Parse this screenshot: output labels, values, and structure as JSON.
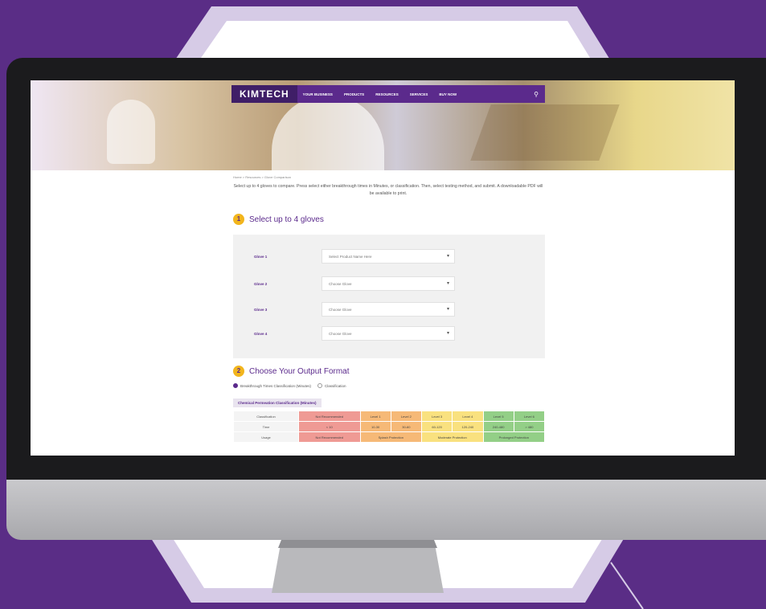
{
  "colors": {
    "background": "#5a2d86",
    "brand_purple": "#5b2a8c",
    "step_badge": "#f2b51d",
    "level_red": "#ef9a94",
    "level_orange": "#f6b977",
    "level_yellow": "#f9e17f",
    "level_green": "#93cf87"
  },
  "header": {
    "logo": "KIMTECH",
    "nav": [
      "YOUR BUSINESS",
      "PRODUCTS",
      "RESOURCES",
      "SERVICES",
      "BUY NOW"
    ],
    "search_icon": "search-icon"
  },
  "breadcrumb": "Home > Resources > Glove Comparison",
  "intro": "Select up to 4 gloves to compare. Press select either breakthrough times in Minutes, or classification. Then, select testing method, and submit. A downloadable PDF will be available to print.",
  "step1": {
    "number": "1",
    "title": "Select up to 4 gloves"
  },
  "gloves": [
    {
      "label": "Glove 1",
      "value": "Select Product Name Here"
    },
    {
      "label": "Glove 2",
      "value": "Choose Glove"
    },
    {
      "label": "Glove 3",
      "value": "Choose Glove"
    },
    {
      "label": "Glove 4",
      "value": "Choose Glove"
    }
  ],
  "step2": {
    "number": "2",
    "title": "Choose Your Output Format"
  },
  "output_options": [
    "Breakthrough Times Classification (Minutes)",
    "Classification"
  ],
  "table": {
    "title": "Chemical Permeation Classification (Minutes)",
    "rows": [
      {
        "head": "Classification",
        "cells": [
          "Not Recommended",
          "Level 1",
          "Level 2",
          "Level 3",
          "Level 4",
          "Level 5",
          "Level 6"
        ]
      },
      {
        "head": "Time",
        "cells": [
          "< 10",
          "10-30",
          "30-60",
          "60-120",
          "120-240",
          "240-480",
          "> 480"
        ]
      },
      {
        "head": "Usage",
        "cells": [
          "Not Recommended",
          "Splash Protection",
          "Moderate Protection",
          "Prolonged Protection"
        ]
      }
    ]
  }
}
